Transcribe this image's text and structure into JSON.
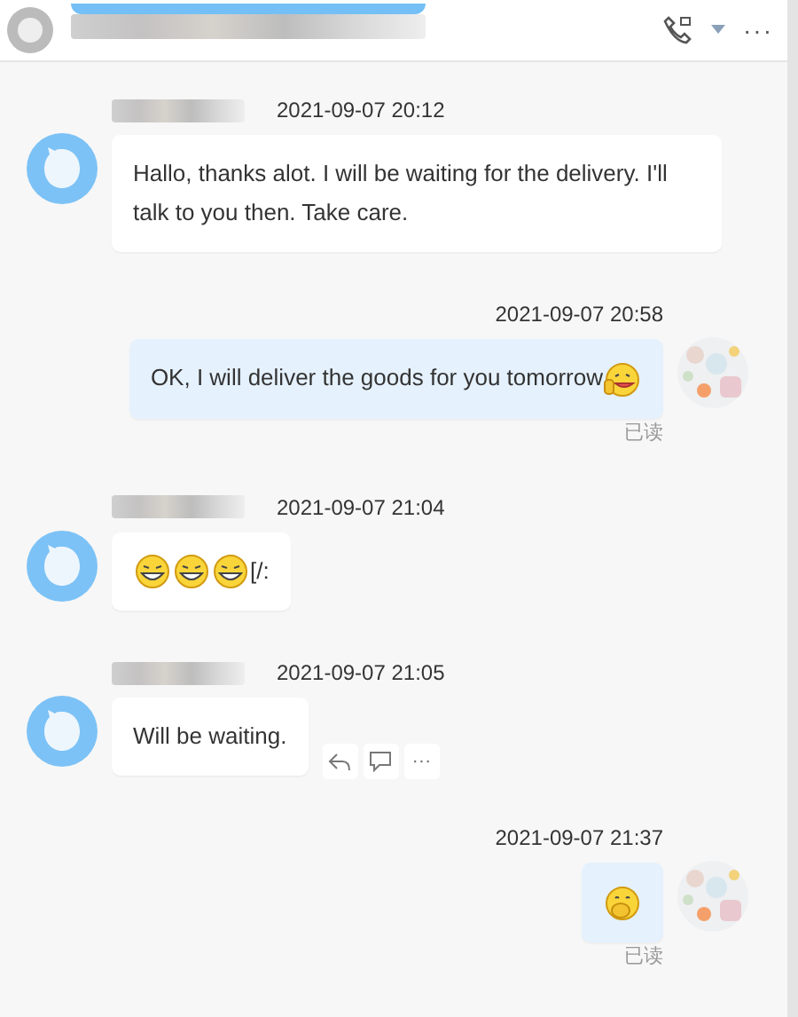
{
  "header": {
    "more_label": "···"
  },
  "messages": [
    {
      "kind": "incoming",
      "time": "2021-09-07 20:12",
      "parts": [
        {
          "kind": "text",
          "text": "Hallo, thanks alot. I will be waiting for the delivery. I'll talk to you then. Take care."
        }
      ]
    },
    {
      "kind": "outgoing",
      "time": "2021-09-07 20:58",
      "parts": [
        {
          "kind": "text",
          "text": "OK, I will deliver the goods for you tomorrow"
        },
        {
          "kind": "wave"
        }
      ],
      "status": "已读"
    },
    {
      "kind": "incoming",
      "time": "2021-09-07 21:04",
      "parts": [
        {
          "kind": "grin"
        },
        {
          "kind": "grin"
        },
        {
          "kind": "grin"
        },
        {
          "kind": "text",
          "text": "[/:"
        }
      ]
    },
    {
      "kind": "incoming",
      "time": "2021-09-07 21:05",
      "parts": [
        {
          "kind": "text",
          "text": "Will be waiting."
        }
      ],
      "hover_tools": true,
      "more_label": "···"
    },
    {
      "kind": "outgoing",
      "time": "2021-09-07 21:37",
      "parts": [
        {
          "kind": "cover"
        }
      ],
      "status": "已读"
    }
  ]
}
